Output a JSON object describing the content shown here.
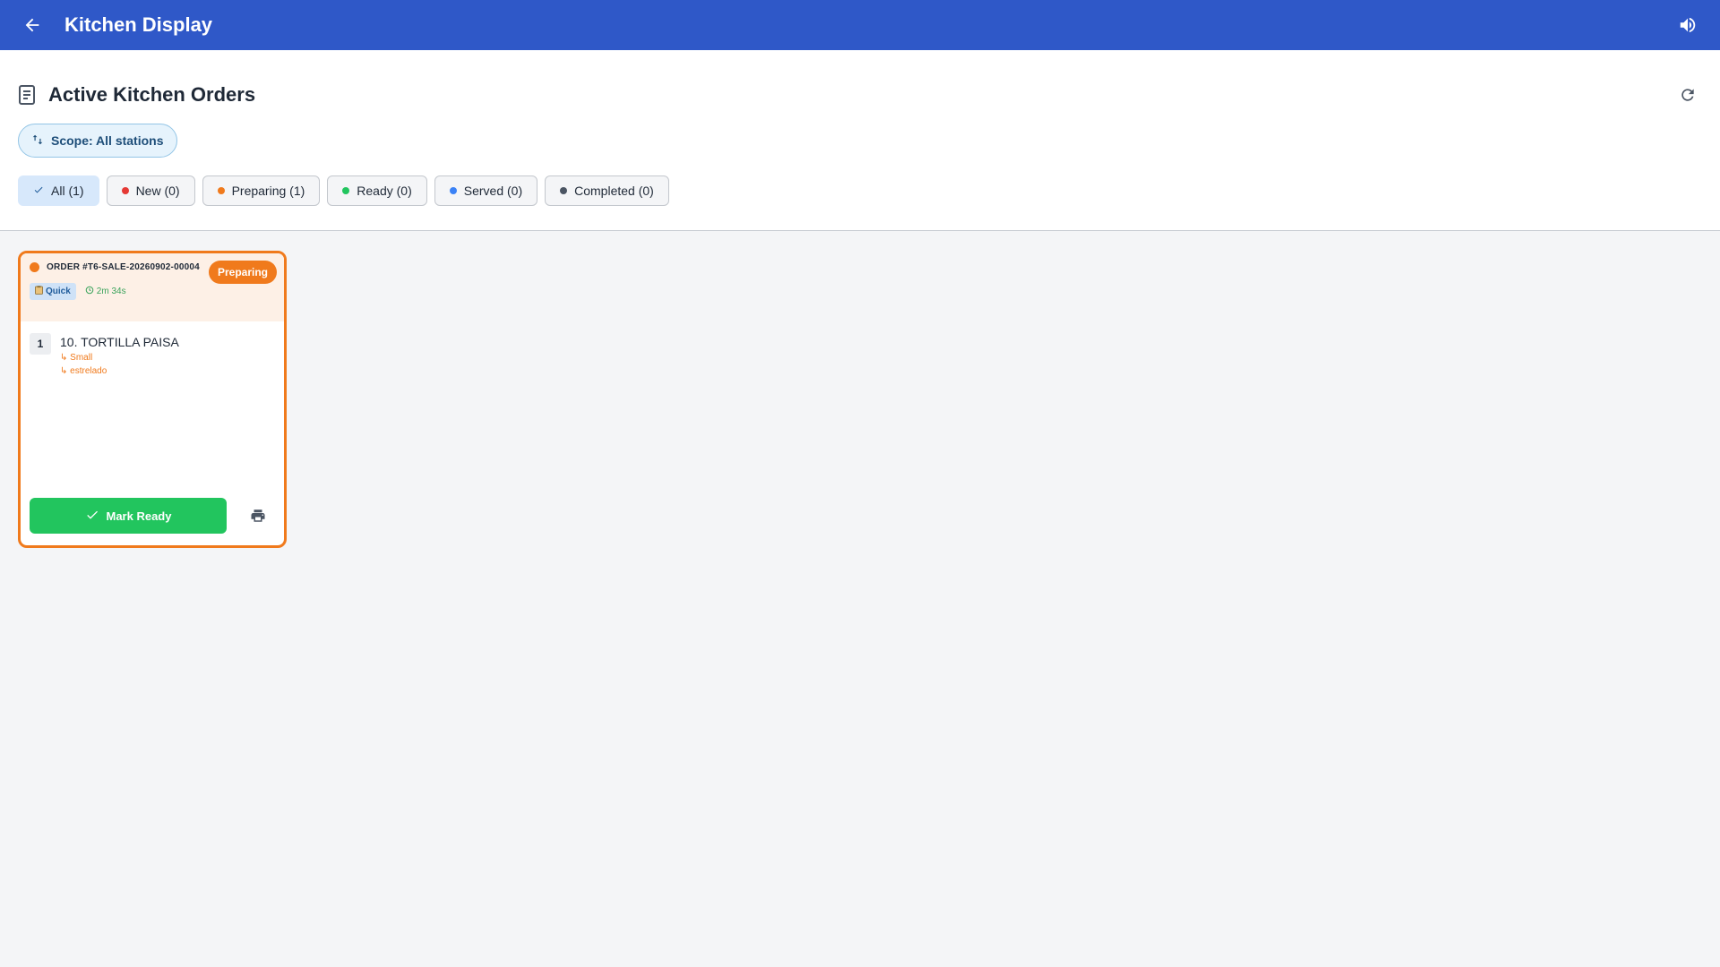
{
  "appbar": {
    "title": "Kitchen Display",
    "back_icon": "arrow-back-icon",
    "sound_icon": "volume-icon",
    "background": "#2f58c8"
  },
  "page": {
    "title": "Active Kitchen Orders",
    "scope_label": "Scope: All stations"
  },
  "filters": [
    {
      "label": "All (1)",
      "active": true,
      "color": null
    },
    {
      "label": "New (0)",
      "active": false,
      "color": "#e53935"
    },
    {
      "label": "Preparing (1)",
      "active": false,
      "color": "#f07a1c"
    },
    {
      "label": "Ready (0)",
      "active": false,
      "color": "#22c55e"
    },
    {
      "label": "Served (0)",
      "active": false,
      "color": "#3b82f6"
    },
    {
      "label": "Completed (0)",
      "active": false,
      "color": "#4b5563"
    }
  ],
  "orders": [
    {
      "number": "ORDER #T6-SALE-20260902-00004",
      "status": "Preparing",
      "status_color": "#f07a1c",
      "tag": "Quick",
      "elapsed": "2m 34s",
      "items": [
        {
          "qty": "1",
          "name": "10. TORTILLA PAISA",
          "modifiers": [
            "Small",
            "estrelado"
          ]
        }
      ],
      "action_label": "Mark Ready"
    }
  ]
}
